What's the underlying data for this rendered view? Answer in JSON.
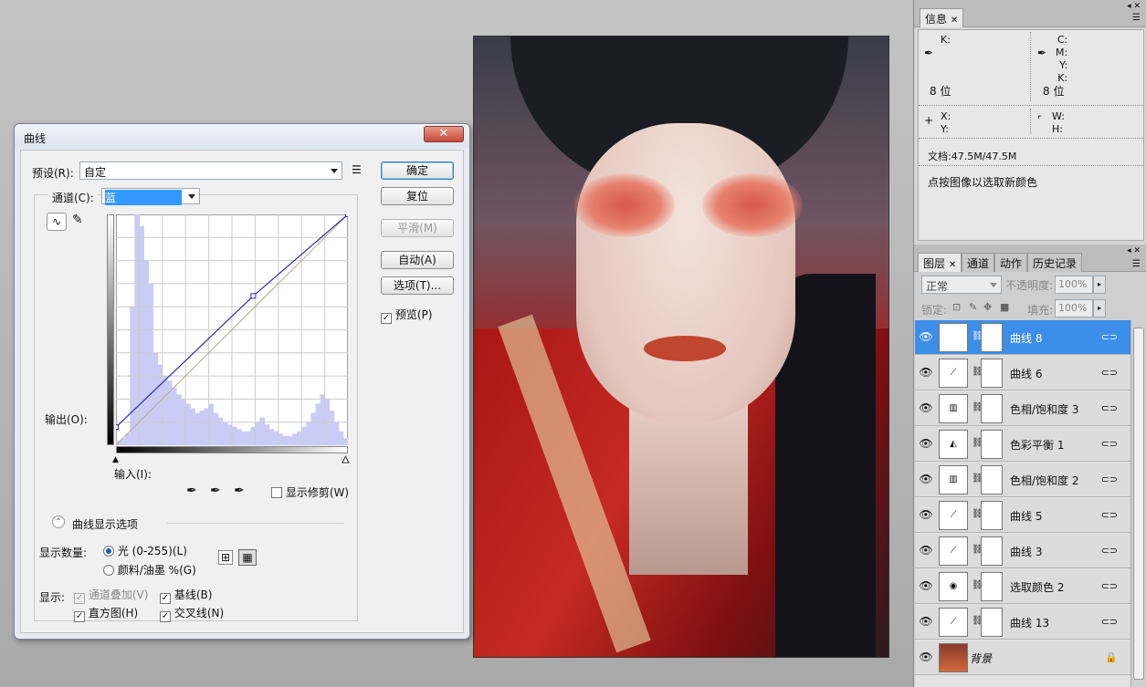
{
  "curves_dialog": {
    "title": "曲线",
    "close_label": "✕",
    "preset_label": "预设(R):",
    "preset_value": "自定",
    "channel_label": "通道(C):",
    "channel_value": "蓝",
    "output_label": "输出(O):",
    "input_label": "输入(I):",
    "show_clipping_label": "显示修剪(W)",
    "display_options_label": "曲线显示选项",
    "show_amount_label": "显示数量:",
    "option_light": "光 (0-255)(L)",
    "option_pigment": "颜料/油墨 %(G)",
    "show_label": "显示:",
    "channel_overlay_label": "通道叠加(V)",
    "baseline_label": "基线(B)",
    "histogram_label": "直方图(H)",
    "intersection_label": "交叉线(N)",
    "buttons": {
      "ok": "确定",
      "reset": "复位",
      "smooth": "平滑(M)",
      "auto": "自动(A)",
      "options": "选项(T)...",
      "preview": "预览(P)"
    },
    "curve_points": [
      [
        0,
        20
      ],
      [
        151,
        165
      ],
      [
        255,
        255
      ]
    ],
    "colors": {
      "curve": "#2a2ab8",
      "histogram": "#c9cdf5"
    }
  },
  "info_panel": {
    "tab_label": "信息",
    "left_k": "K:",
    "bits_left": "8 位",
    "cmyk_labels": "C:\nM:\nY:\nK:",
    "bits_right": "8 位",
    "xy_labels": "X:\nY:",
    "wh_labels": "W:\nH:",
    "doc_size": "文档:47.5M/47.5M",
    "hint": "点按图像以选取新颜色"
  },
  "layers_panel": {
    "tabs": [
      "图层",
      "通道",
      "动作",
      "历史记录"
    ],
    "blend_mode": "正常",
    "opacity_label": "不透明度:",
    "opacity_value": "100%",
    "lock_label": "锁定:",
    "fill_label": "填充:",
    "fill_value": "100%",
    "layers": [
      {
        "name": "曲线 8",
        "icon": "curves-adjustment-icon",
        "selected": true
      },
      {
        "name": "曲线 6",
        "icon": "curves-adjustment-icon",
        "selected": false
      },
      {
        "name": "色相/饱和度 3",
        "icon": "hue-saturation-icon",
        "selected": false
      },
      {
        "name": "色彩平衡 1",
        "icon": "color-balance-icon",
        "selected": false
      },
      {
        "name": "色相/饱和度 2",
        "icon": "hue-saturation-icon",
        "selected": false
      },
      {
        "name": "曲线 5",
        "icon": "curves-adjustment-icon",
        "selected": false
      },
      {
        "name": "曲线 3",
        "icon": "curves-adjustment-icon",
        "selected": false
      },
      {
        "name": "选取颜色 2",
        "icon": "selective-color-icon",
        "selected": false
      },
      {
        "name": "曲线 13",
        "icon": "curves-adjustment-icon",
        "selected": false
      },
      {
        "name": "背景",
        "icon": "image-thumbnail-icon",
        "selected": false
      }
    ]
  }
}
